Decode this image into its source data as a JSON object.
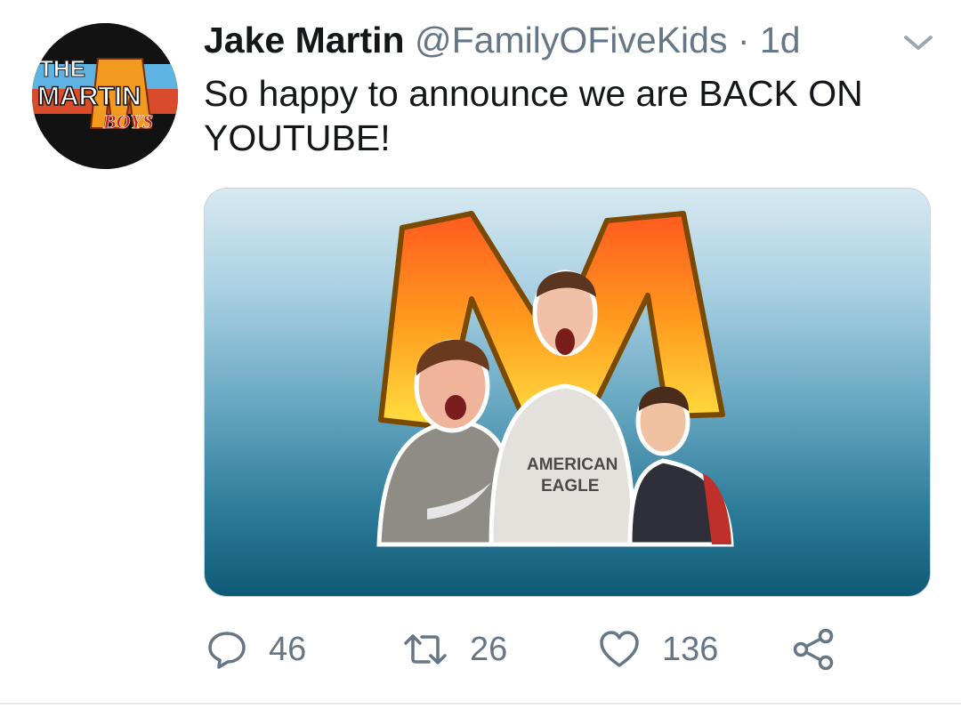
{
  "tweet": {
    "author_name": "Jake Martin",
    "author_handle": "@FamilyOFiveKids",
    "separator": "·",
    "time": "1d",
    "text": "So happy to announce we are BACK ON YOUTUBE!",
    "avatar_logo_text": [
      "THE",
      "MARTIN",
      "BOYS"
    ],
    "media_letter": "M",
    "shirt_text": [
      "AMERICAN",
      "EAGLE"
    ]
  },
  "actions": {
    "replies": "46",
    "retweets": "26",
    "likes": "136"
  },
  "colors": {
    "text_primary": "#14171a",
    "text_secondary": "#657786",
    "divider": "#e6ecf0",
    "logo_orange": "#f39a1e"
  },
  "icons": [
    "chevron-down-icon",
    "reply-icon",
    "retweet-icon",
    "like-icon",
    "share-icon"
  ]
}
